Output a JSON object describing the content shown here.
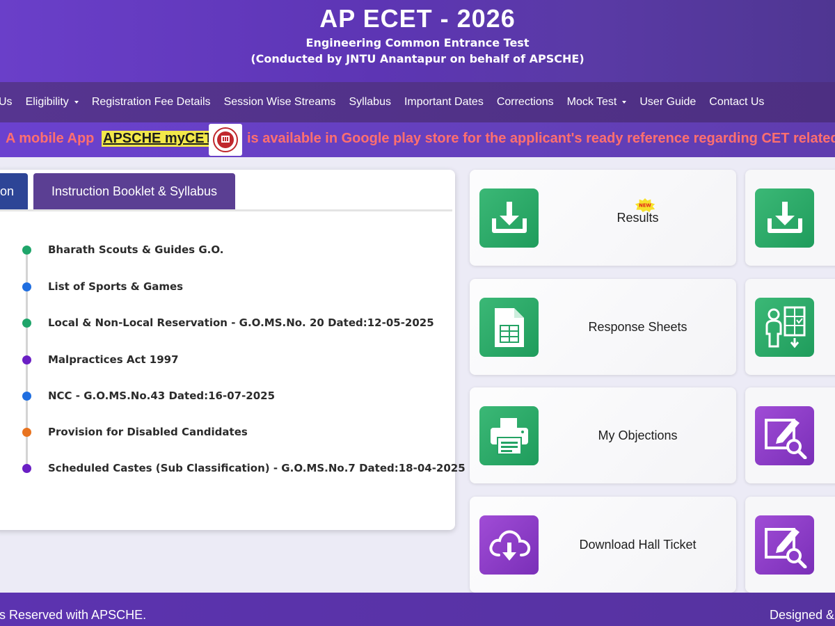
{
  "header": {
    "title": "AP ECET - 2026",
    "subtitle": "Engineering Common Entrance Test",
    "subtitle2": "(Conducted by JNTU Anantapur on behalf of APSCHE)"
  },
  "nav": {
    "items": [
      {
        "label": "Us",
        "dropdown": false
      },
      {
        "label": "Eligibility",
        "dropdown": true
      },
      {
        "label": "Registration Fee Details",
        "dropdown": false
      },
      {
        "label": "Session Wise Streams",
        "dropdown": false
      },
      {
        "label": "Syllabus",
        "dropdown": false
      },
      {
        "label": "Important Dates",
        "dropdown": false
      },
      {
        "label": "Corrections",
        "dropdown": false
      },
      {
        "label": "Mock Test",
        "dropdown": true
      },
      {
        "label": "User Guide",
        "dropdown": false
      },
      {
        "label": "Contact Us",
        "dropdown": false
      }
    ]
  },
  "marquee": {
    "prefix": "A mobile App",
    "app_name": "APSCHE myCET",
    "suffix": "is available in Google play store for the applicant's ready reference regarding CET related"
  },
  "tabs": {
    "active_label": "on",
    "inactive_label": "Instruction Booklet & Syllabus"
  },
  "timeline": [
    {
      "text": "Bharath Scouts & Guides G.O.",
      "color": "#1fa56a"
    },
    {
      "text": "List of Sports & Games",
      "color": "#1f6ee0"
    },
    {
      "text": "Local & Non-Local Reservation - G.O.MS.No. 20 Dated:12-05-2025",
      "color": "#1fa56a"
    },
    {
      "text": "Malpractices Act 1997",
      "color": "#6a1fc4"
    },
    {
      "text": "NCC - G.O.MS.No.43 Dated:16-07-2025",
      "color": "#1f6ee0"
    },
    {
      "text": "Provision for Disabled Candidates",
      "color": "#e8731f"
    },
    {
      "text": "Scheduled Castes (Sub Classification) - G.O.MS.No.7 Dated:18-04-2025",
      "color": "#6a1fc4"
    }
  ],
  "cards": [
    {
      "label": "Results",
      "icon": "download-icon",
      "badge": "NEW"
    },
    {
      "label": "Response Sheets",
      "icon": "spreadsheet-icon"
    },
    {
      "label": "My Objections",
      "icon": "printer-icon"
    },
    {
      "label": "Download Hall Ticket",
      "icon": "cloud-download-icon"
    }
  ],
  "right_cards": [
    {
      "icon": "download-icon"
    },
    {
      "icon": "user-grid-icon"
    },
    {
      "icon": "edit-search-icon"
    },
    {
      "icon": "edit-search-icon"
    }
  ],
  "colors": {
    "header": "#6a3fc9",
    "nav": "#563590",
    "tab_active": "#2d4596",
    "tab_inactive": "#5b3f93",
    "icon_green": "#2aab6b",
    "icon_purple": "#8b3cc8",
    "marquee_text": "#ff6f6f"
  },
  "footer": {
    "left": "ts Reserved with APSCHE.",
    "right": "Designed &"
  }
}
